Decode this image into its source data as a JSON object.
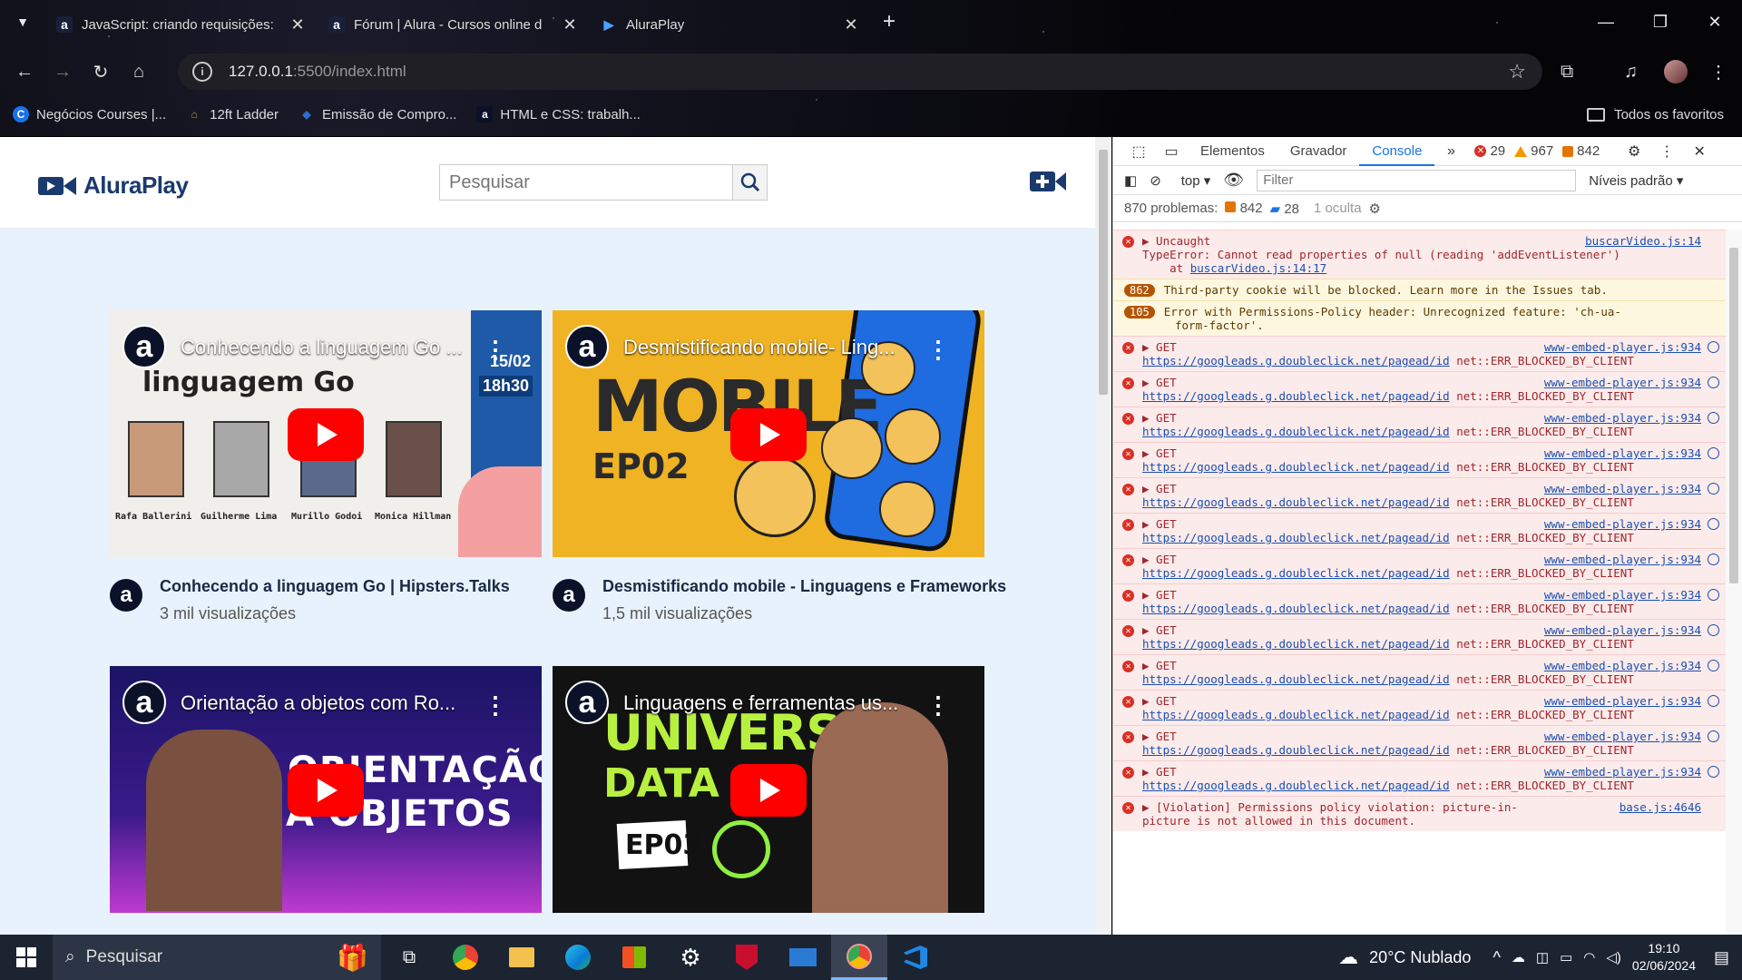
{
  "browser": {
    "tabs": [
      {
        "title": "JavaScript: criando requisições:",
        "icon": "alura-icon"
      },
      {
        "title": "Fórum | Alura - Cursos online d",
        "icon": "alura-icon"
      },
      {
        "title": "AluraPlay",
        "icon": "play-icon"
      }
    ],
    "url_host": "127.0.0.1",
    "url_rest": ":5500/index.html",
    "bookmarks": [
      {
        "label": "Negócios Courses |...",
        "icon": "C",
        "color": "#1a73e8"
      },
      {
        "label": "12ft Ladder",
        "icon": "⌂",
        "color": "#c59a3c"
      },
      {
        "label": "Emissão de Compro...",
        "icon": "◆",
        "color": "#2c6fd1"
      },
      {
        "label": "HTML e CSS: trabalh...",
        "icon": "a",
        "color": "#0a1128"
      }
    ],
    "all_bookmarks": "Todos os favoritos"
  },
  "site": {
    "logo": "AluraPlay",
    "search_placeholder": "Pesquisar",
    "videos": [
      {
        "thumb_title": "Conhecendo a linguagem Go ...",
        "title": "Conhecendo a linguagem Go | Hipsters.Talks",
        "views": "3 mil visualizações",
        "style": "go"
      },
      {
        "thumb_title": "Desmistificando mobile- Ling...",
        "title": "Desmistificando mobile - Linguagens e Frameworks",
        "views": "1,5 mil visualizações",
        "style": "mobile"
      },
      {
        "thumb_title": "Orientação a objetos com Ro...",
        "title": "",
        "views": "",
        "style": "oo"
      },
      {
        "thumb_title": "Linguagens e ferramentas us...",
        "title": "",
        "views": "",
        "style": "ds"
      }
    ],
    "thumb_texts": {
      "go_big": "linguagem Go",
      "go_date": "15/02",
      "go_time": "18h30",
      "go_people": [
        "Rafa Ballerini",
        "Guilherme Lima",
        "Murillo Godoi",
        "Monica Hillman"
      ],
      "mobile_big": "MOBILE",
      "mobile_ep": "EP02",
      "oo_big1": "ORIENTAÇÃO",
      "oo_big2": "A OBJETOS",
      "ds_big1": "UNIVERSO",
      "ds_big2": "DATA SCI",
      "ds_ep": "EP03"
    }
  },
  "devtools": {
    "tabs": [
      "Elementos",
      "Gravador",
      "Console"
    ],
    "errors": "29",
    "warnings": "967",
    "issues": "842",
    "context": "top",
    "filter_placeholder": "Filter",
    "levels": "Níveis padrão",
    "problems": "870 problemas:",
    "problems_issues": "842",
    "problems_info": "28",
    "hidden": "1 oculta",
    "messages": [
      {
        "kind": "error",
        "line1": "▶ Uncaught",
        "line2": "TypeError: Cannot read properties of null (reading 'addEventListener')",
        "line3_pre": "    at ",
        "line3_link": "buscarVideo.js:14:17",
        "src": "buscarVideo.js:14"
      },
      {
        "kind": "warn",
        "badge": "862",
        "line1": "Third-party cookie will be blocked. Learn more in the Issues tab."
      },
      {
        "kind": "warn",
        "badge": "105",
        "line1": "Error with Permissions-Policy header: Unrecognized feature: 'ch-ua-",
        "line2": "form-factor'."
      },
      {
        "kind": "net"
      },
      {
        "kind": "net"
      },
      {
        "kind": "net"
      },
      {
        "kind": "net"
      },
      {
        "kind": "net"
      },
      {
        "kind": "net"
      },
      {
        "kind": "net"
      },
      {
        "kind": "net"
      },
      {
        "kind": "net"
      },
      {
        "kind": "net"
      },
      {
        "kind": "net"
      },
      {
        "kind": "net"
      },
      {
        "kind": "net"
      },
      {
        "kind": "error",
        "line1": "▶ [Violation] Permissions policy violation: picture-in-",
        "line2": "picture is not allowed in this document.",
        "src": "base.js:4646"
      }
    ],
    "net_get": "▶ GET",
    "net_src": "www-embed-player.js:934",
    "net_url": "https://googleads.g.doubleclick.net/pagead/id",
    "net_err": "net::ERR_BLOCKED_BY_CLIENT"
  },
  "taskbar": {
    "search": "Pesquisar",
    "weather": "20°C  Nublado",
    "time": "19:10",
    "date": "02/06/2024"
  }
}
